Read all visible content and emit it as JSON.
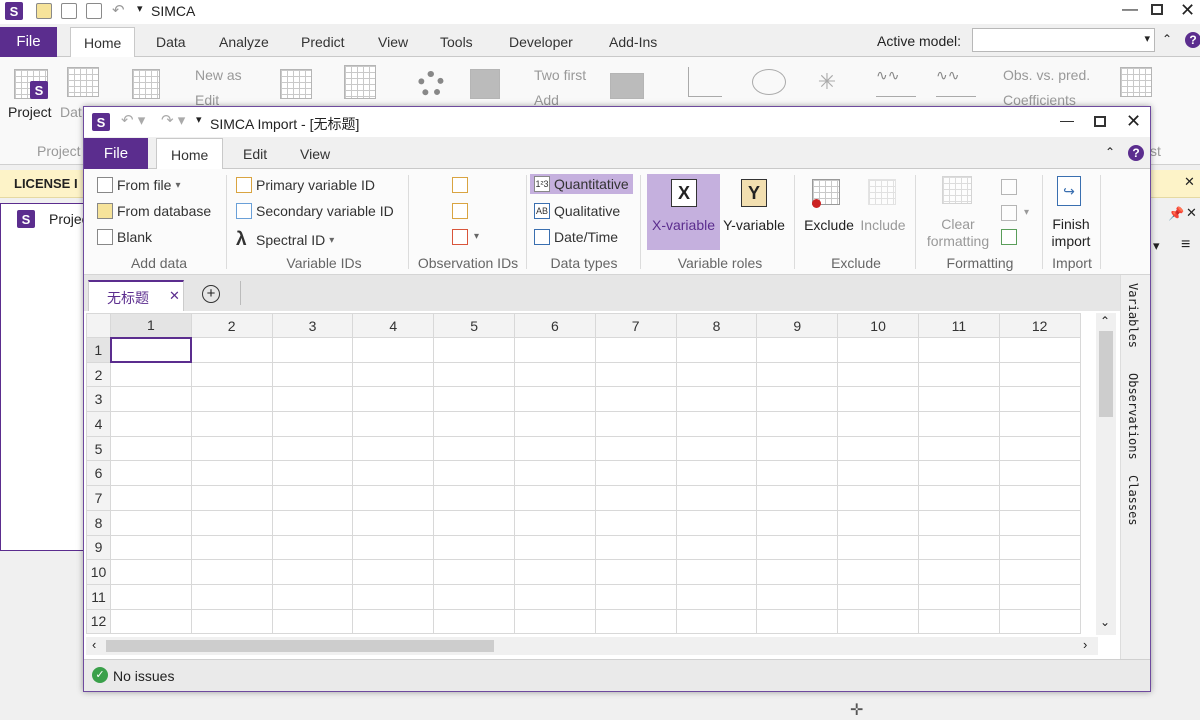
{
  "app": {
    "title": "SIMCA",
    "menu": {
      "file": "File",
      "tabs": [
        "Home",
        "Data",
        "Analyze",
        "Predict",
        "View",
        "Tools",
        "Developer",
        "Add-Ins"
      ]
    },
    "active_model_label": "Active model:",
    "ribbon": {
      "new_as": "New as",
      "edit": "Edit",
      "two_first": "Two first",
      "add": "Add",
      "obs_vs_pred": "Obs. vs. pred.",
      "coefficients": "Coefficients",
      "project": "Project",
      "dat": "Dat",
      "project_group": "Project",
      "st": "st"
    },
    "license_bar": "LICENSE I",
    "project_panel_label": "Projec"
  },
  "dialog": {
    "title": "SIMCA Import - [无标题]",
    "tabs": {
      "file": "File",
      "home": "Home",
      "edit": "Edit",
      "view": "View"
    },
    "add_data": {
      "from_file": "From file",
      "from_database": "From database",
      "blank": "Blank",
      "group": "Add data"
    },
    "variable_ids": {
      "primary": "Primary variable ID",
      "secondary": "Secondary variable ID",
      "spectral": "Spectral ID",
      "group": "Variable IDs"
    },
    "observation_ids": {
      "group": "Observation IDs"
    },
    "data_types": {
      "quantitative": "Quantitative",
      "qualitative": "Qualitative",
      "datetime": "Date/Time",
      "group": "Data types"
    },
    "variable_roles": {
      "x_letter": "X",
      "y_letter": "Y",
      "x": "X-variable",
      "y": "Y-variable",
      "group": "Variable roles"
    },
    "exclude": {
      "exclude": "Exclude",
      "include": "Include",
      "group": "Exclude"
    },
    "formatting": {
      "clear1": "Clear",
      "clear2": "formatting",
      "group": "Formatting"
    },
    "import": {
      "finish1": "Finish",
      "finish2": "import",
      "group": "Import"
    },
    "sheet_tab": "无标题",
    "columns": [
      "1",
      "2",
      "3",
      "4",
      "5",
      "6",
      "7",
      "8",
      "9",
      "10",
      "11",
      "12"
    ],
    "rows": [
      "1",
      "2",
      "3",
      "4",
      "5",
      "6",
      "7",
      "8",
      "9",
      "10",
      "11",
      "12"
    ],
    "side_tabs": [
      "Variables",
      "Observations",
      "Classes"
    ],
    "status": "No issues"
  },
  "colors": {
    "brand": "#5b2d8e",
    "selected_role": "#c5b0de",
    "license_bar": "#fdf3c8"
  }
}
